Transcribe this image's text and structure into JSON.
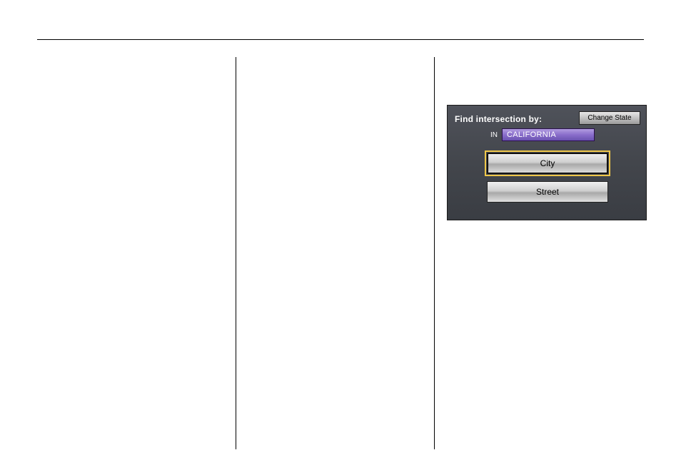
{
  "nav_screen": {
    "header": "Find intersection by:",
    "change_state_label": "Change State",
    "in_label": "IN",
    "state_value": "CALIFORNIA",
    "city_button": "City",
    "street_button": "Street"
  }
}
